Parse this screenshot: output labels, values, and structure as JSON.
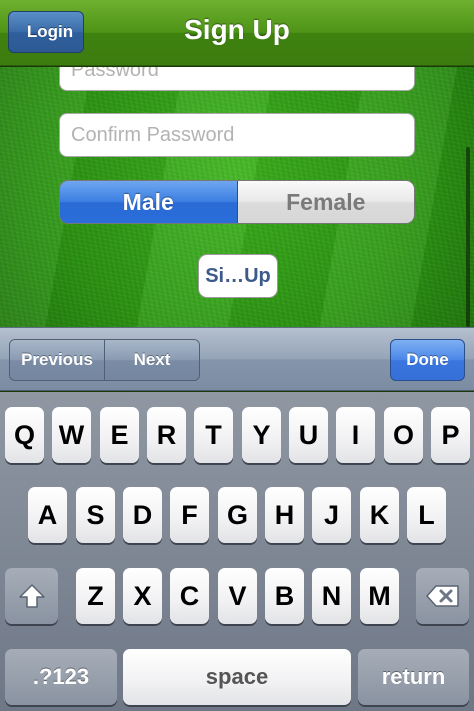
{
  "navbar": {
    "title": "Sign Up",
    "back_label": "Login"
  },
  "form": {
    "password_placeholder": "Password",
    "confirm_password_placeholder": "Confirm Password",
    "gender": {
      "options": [
        "Male",
        "Female"
      ],
      "selected": "Male"
    },
    "signup_button_label": "Si…Up"
  },
  "toolbar": {
    "previous_label": "Previous",
    "next_label": "Next",
    "done_label": "Done"
  },
  "keyboard": {
    "row1": [
      "Q",
      "W",
      "E",
      "R",
      "T",
      "Y",
      "U",
      "I",
      "O",
      "P"
    ],
    "row2": [
      "A",
      "S",
      "D",
      "F",
      "G",
      "H",
      "J",
      "K",
      "L"
    ],
    "row3": [
      "Z",
      "X",
      "C",
      "V",
      "B",
      "N",
      "M"
    ],
    "numbers_label": ".?123",
    "space_label": "space",
    "return_label": "return",
    "shift_icon": "shift-arrow-icon",
    "delete_icon": "backspace-icon"
  },
  "colors": {
    "navbar_green": "#4e9418",
    "selected_segment_blue": "#3b7ee2",
    "done_blue": "#4a86e8"
  }
}
